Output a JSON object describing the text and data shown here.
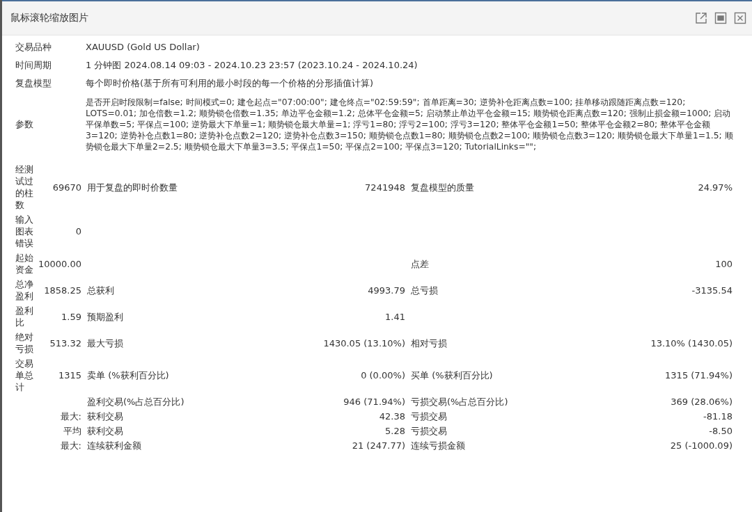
{
  "window": {
    "title": "鼠标滚轮缩放图片"
  },
  "info": [
    {
      "label": "交易品种",
      "value": "XAUUSD (Gold US Dollar)"
    },
    {
      "label": "时间周期",
      "value": "1 分钟图 2024.08.14 09:03 - 2024.10.23 23:57 (2023.10.24 - 2024.10.24)"
    },
    {
      "label": "复盘模型",
      "value": "每个即时价格(基于所有可利用的最小时段的每一个价格的分形插值计算)"
    },
    {
      "label": "参数",
      "value": "是否开启时段限制=false; 时间模式=0; 建仓起点=\"07:00:00\"; 建仓终点=\"02:59:59\"; 首单距离=30; 逆势补仓距离点数=100; 挂单移动跟随距离点数=120; LOTS=0.01; 加仓倍数=1.2; 顺势锁仓倍数=1.35; 单边平仓金额=1.2; 总体平仓金额=5; 启动禁止单边平仓金额=15; 顺势锁仓距离点数=120; 强制止损金额=1000; 启动平保单数=5; 平保点=100; 逆势最大下单量=1; 顺势锁仓最大单量=1; 浮亏1=80; 浮亏2=100; 浮亏3=120; 整体平仓金额1=50; 整体平仓金额2=80; 整体平仓金额3=120; 逆势补仓点数1=80; 逆势补仓点数2=120; 逆势补仓点数3=150; 顺势锁仓点数1=80; 顺势锁仓点数2=100; 顺势锁仓点数3=120; 顺势锁仓最大下单量1=1.5; 顺势锁仓最大下单量2=2.5; 顺势锁仓最大下单量3=3.5; 平保点1=50; 平保点2=100; 平保点3=120; TutorialLinks=\"\";"
    }
  ],
  "stats": [
    {
      "kind": "main",
      "label": "经测试过的柱数",
      "value": "69670",
      "label_2": "用于复盘的即时价数量",
      "value_2": "7241948",
      "label_3": "复盘模型的质量",
      "value_3": "24.97%"
    },
    {
      "kind": "main",
      "label": "输入图表错误",
      "value": "0"
    },
    {
      "kind": "main",
      "label": "起始资金",
      "value": "10000.00",
      "label_3": "点差",
      "value_3": "100"
    },
    {
      "kind": "main",
      "label": "总净盈利",
      "value": "1858.25",
      "label_2": "总获利",
      "value_2": "4993.79",
      "label_3": "总亏损",
      "value_3": "-3135.54"
    },
    {
      "kind": "main",
      "label": "盈利比",
      "value": "1.59",
      "label_2": "预期盈利",
      "value_2": "1.41"
    },
    {
      "kind": "main",
      "label": "绝对亏损",
      "value": "513.32",
      "label_2": "最大亏损",
      "value_2": "1430.05 (13.10%)",
      "label_3": "相对亏损",
      "value_3": "13.10% (1430.05)"
    },
    {
      "kind": "main",
      "label": "交易单总计",
      "value": "1315",
      "label_2": "卖单 (%获利百分比)",
      "value_2": "0 (0.00%)",
      "label_3": "买单 (%获利百分比)",
      "value_3": "1315 (71.94%)"
    },
    {
      "kind": "sub",
      "label_2": "盈利交易(%占总百分比)",
      "value_2": "946 (71.94%)",
      "label_3": "亏损交易(%占总百分比)",
      "value_3": "369 (28.06%)"
    },
    {
      "kind": "sub",
      "label": "最大:",
      "label_2": "获利交易",
      "value_2": "42.38",
      "label_3": "亏损交易",
      "value_3": "-81.18"
    },
    {
      "kind": "sub",
      "label": "平均",
      "label_2": "获利交易",
      "value_2": "5.28",
      "label_3": "亏损交易",
      "value_3": "-8.50"
    },
    {
      "kind": "sub",
      "label": "最大:",
      "label_2": "连续获利金额",
      "value_2": "21 (247.77)",
      "label_3": "连续亏损金额",
      "value_3": "25 (-1000.09)"
    }
  ]
}
